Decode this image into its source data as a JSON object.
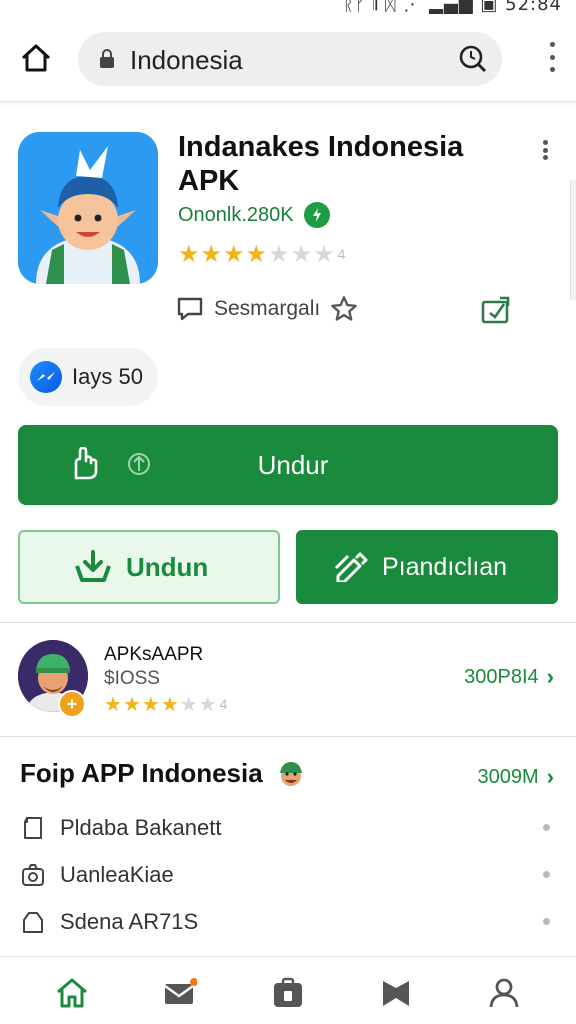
{
  "status_bar": {
    "text": "ᚱᚠ 𝄂 ᛞ ⋰ ▂▄▆ ▣ 52:84"
  },
  "browser": {
    "url_text": "Indonesia"
  },
  "app": {
    "title": "Indanakes Indonesia APK",
    "developer": "Ononlk.280K",
    "rating": 3.5,
    "rating_suffix": "4",
    "wishlist_label": "Sesmargalı"
  },
  "chip": {
    "label": "Iays 50"
  },
  "buttons": {
    "primary_label": "Undur",
    "outline_label": "Undun",
    "green_label": "Pıandıclıan"
  },
  "related": {
    "title": "APKsAAPR",
    "subtitle": "$IOSS",
    "rating": 4,
    "rating_suffix": "4",
    "badge": "+",
    "link_label": "300P8I4",
    "chevron": "›"
  },
  "section": {
    "title": "Foip APP Indonesia",
    "link_label": "3009M",
    "chevron": "›",
    "items": [
      {
        "label": "Pldaba Bakanett",
        "icon": "tag-icon"
      },
      {
        "label": "UanleaKiae",
        "icon": "camera-icon"
      },
      {
        "label": "Sdena AR71S",
        "icon": "bag-icon"
      }
    ]
  },
  "bottom_nav": {
    "items": [
      "home-icon",
      "mail-icon",
      "store-icon",
      "bookmark-icon",
      "profile-icon"
    ],
    "active_color": "#1a8b3c"
  },
  "colors": {
    "brand_green": "#1a8b3c",
    "icon_blue": "#2b9af0",
    "star_gold": "#f3b41b"
  }
}
